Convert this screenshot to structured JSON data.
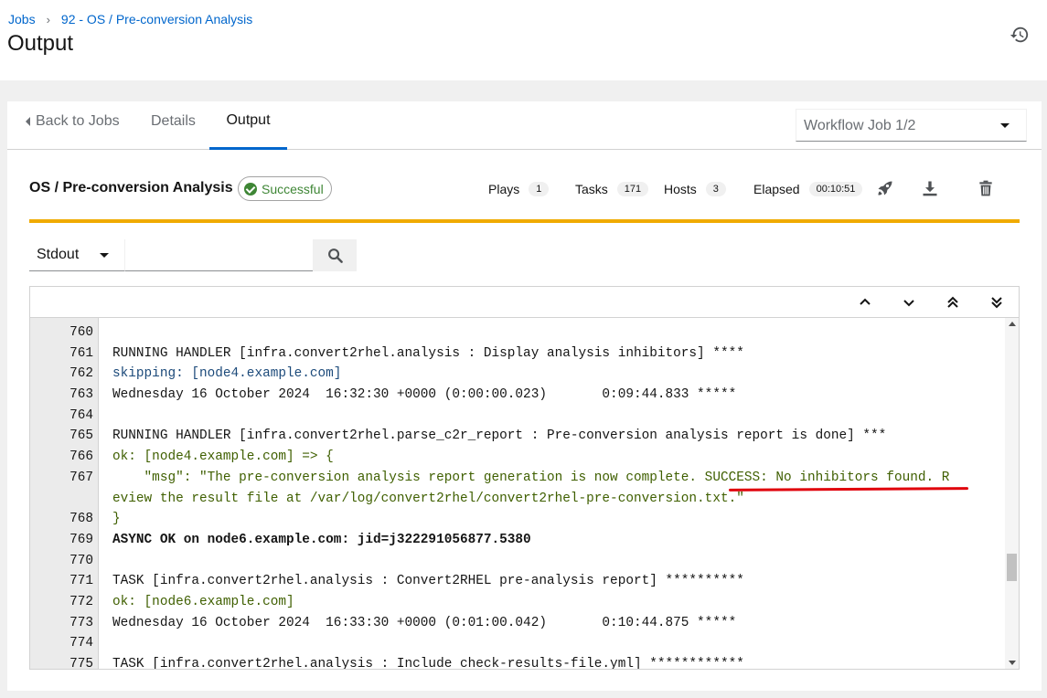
{
  "breadcrumb": {
    "root": "Jobs",
    "current": "92 - OS / Pre-conversion Analysis"
  },
  "page": {
    "title": "Output"
  },
  "tabs": {
    "back": "Back to Jobs",
    "details": "Details",
    "output": "Output"
  },
  "workflow_select": {
    "value": "Workflow Job 1/2"
  },
  "job": {
    "title": "OS / Pre-conversion Analysis",
    "status": "Successful",
    "plays_label": "Plays",
    "plays": "1",
    "tasks_label": "Tasks",
    "tasks": "171",
    "hosts_label": "Hosts",
    "hosts": "3",
    "elapsed_label": "Elapsed",
    "elapsed": "00:10:51"
  },
  "search": {
    "filter": "Stdout",
    "query": ""
  },
  "colors": {
    "link": "#0066cc",
    "progress": "#f0ab00",
    "success": "#3e8635",
    "highlight": "#e0000b"
  },
  "icons": [
    "history-icon",
    "rocket-icon",
    "download-icon",
    "trash-icon",
    "search-icon",
    "chevron-up-icon",
    "chevron-down-icon",
    "double-chevron-up-icon",
    "double-chevron-down-icon"
  ],
  "output": {
    "lines": [
      {
        "num": "760",
        "text": ""
      },
      {
        "num": "761",
        "text": "RUNNING HANDLER [infra.convert2rhel.analysis : Display analysis inhibitors] ****"
      },
      {
        "num": "762",
        "text": "skipping: [node4.example.com]"
      },
      {
        "num": "763",
        "text": "Wednesday 16 October 2024  16:32:30 +0000 (0:00:00.023)       0:09:44.833 *****"
      },
      {
        "num": "764",
        "text": ""
      },
      {
        "num": "765",
        "text": "RUNNING HANDLER [infra.convert2rhel.parse_c2r_report : Pre-conversion analysis report is done] ***"
      },
      {
        "num": "766",
        "text": "ok: [node4.example.com] => {"
      },
      {
        "num": "767",
        "text": "    \"msg\": \"The pre-conversion analysis report generation is now complete. SUCCESS: No inhibitors found. R"
      },
      {
        "num": "",
        "text": "eview the result file at /var/log/convert2rhel/convert2rhel-pre-conversion.txt.\""
      },
      {
        "num": "768",
        "text": "}"
      },
      {
        "num": "769",
        "text": "ASYNC OK on node6.example.com: jid=j322291056877.5380"
      },
      {
        "num": "770",
        "text": ""
      },
      {
        "num": "771",
        "text": "TASK [infra.convert2rhel.analysis : Convert2RHEL pre-analysis report] **********"
      },
      {
        "num": "772",
        "text": "ok: [node6.example.com]"
      },
      {
        "num": "773",
        "text": "Wednesday 16 October 2024  16:33:30 +0000 (0:01:00.042)       0:10:44.875 *****"
      },
      {
        "num": "774",
        "text": ""
      },
      {
        "num": "775",
        "text": "TASK [infra.convert2rhel.analysis : Include check-results-file.yml] ************"
      }
    ]
  }
}
